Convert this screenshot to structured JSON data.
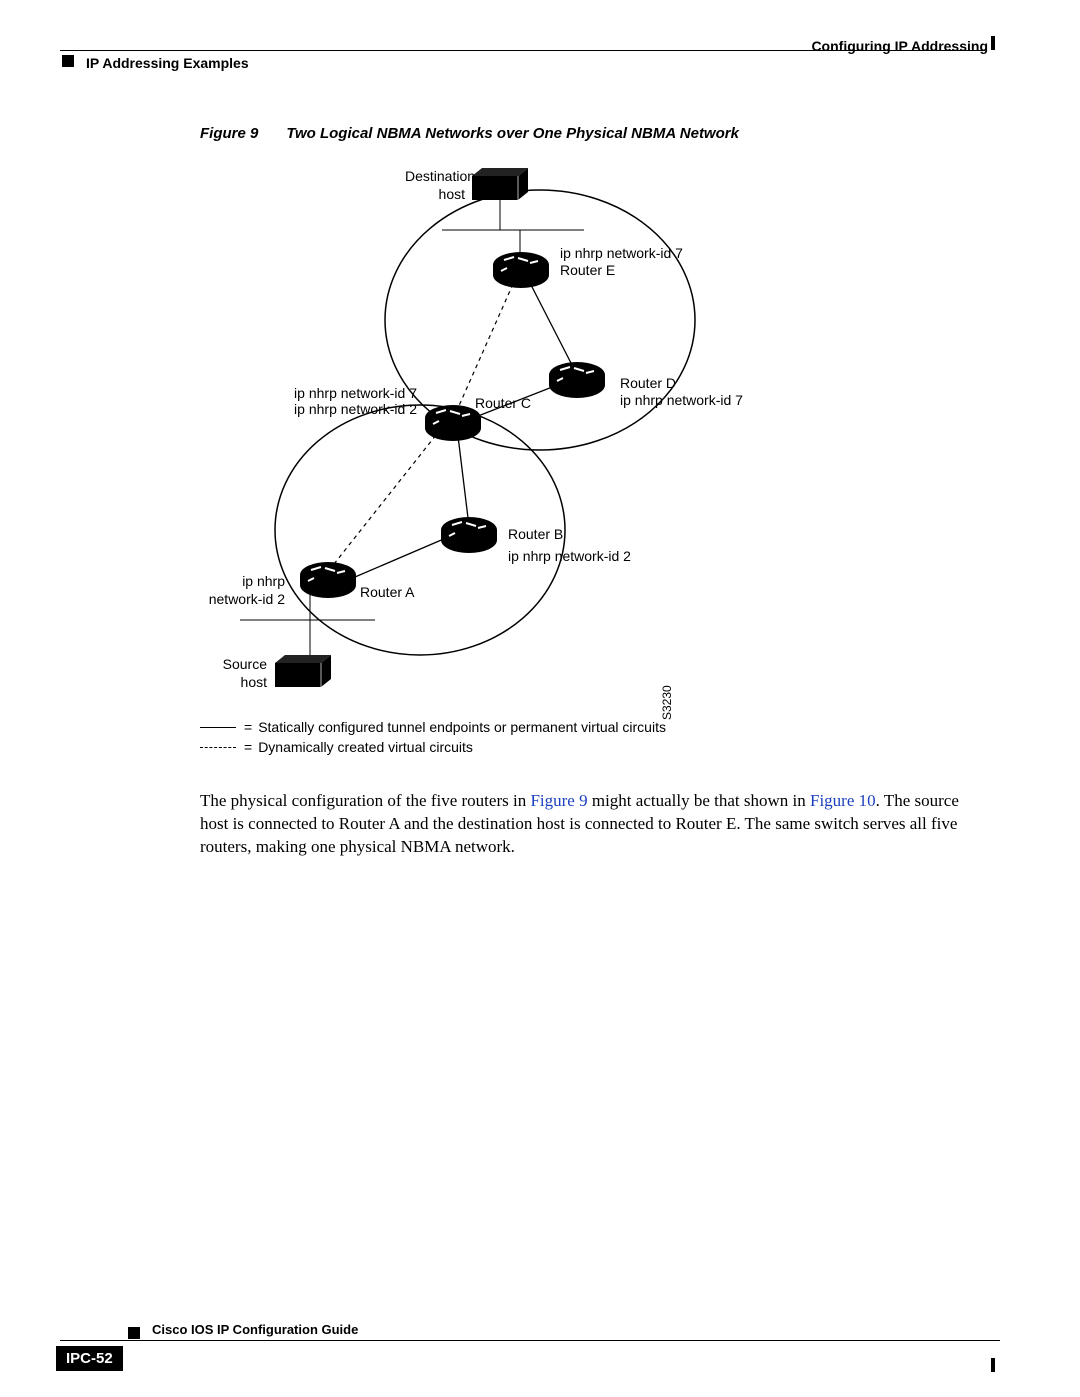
{
  "header": {
    "left": "IP Addressing Examples",
    "right": "Configuring IP Addressing"
  },
  "figure": {
    "label": "Figure 9",
    "title": "Two Logical NBMA Networks over One Physical NBMA Network",
    "labels": {
      "dest_host": "Destination\nhost",
      "router_e": "Router E",
      "router_e_id": "ip nhrp network-id 7",
      "router_d": "Router D",
      "router_d_id": "ip nhrp network-id 7",
      "router_c": "Router C",
      "router_c_id1": "ip nhrp network-id 7",
      "router_c_id2": "ip nhrp network-id 2",
      "router_b": "Router B",
      "router_b_id": "ip nhrp network-id 2",
      "router_a": "Router A",
      "router_a_id": "ip nhrp\nnetwork-id 2",
      "source_host": "Source\nhost"
    },
    "legend": {
      "static": "Statically configured tunnel endpoints or permanent virtual circuits",
      "dynamic": "Dynamically created virtual circuits",
      "code": "S3230"
    }
  },
  "body": {
    "t1": "The physical configuration of the five routers in ",
    "link1": "Figure 9",
    "t2": " might actually be that shown in ",
    "link2": "Figure 10",
    "t3": ". The source host is connected to Router A and the destination host is connected to Router E. The same switch serves all five routers, making one physical NBMA network."
  },
  "footer": {
    "guide": "Cisco IOS IP Configuration Guide",
    "page": "IPC-52"
  }
}
